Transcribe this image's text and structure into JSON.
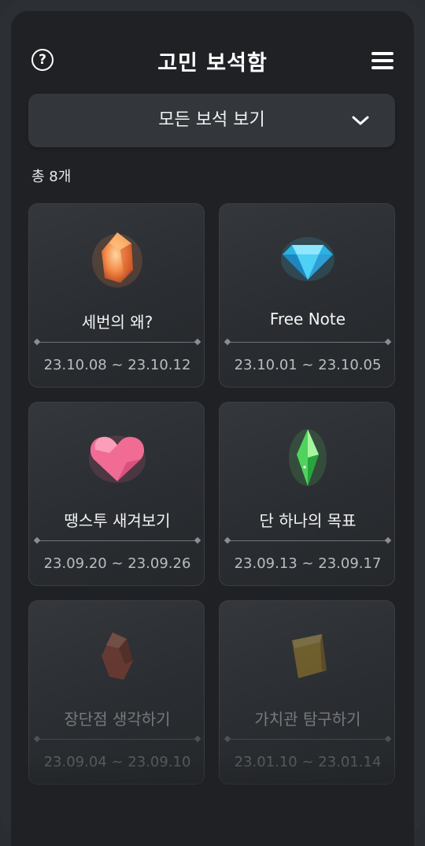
{
  "header": {
    "title": "고민 보석함",
    "help_symbol": "?"
  },
  "filter": {
    "label": "모든 보석 보기"
  },
  "summary": {
    "count_text": "총 8개"
  },
  "cards": [
    {
      "title": "세번의 왜?",
      "date": "23.10.08 ~ 23.10.12",
      "gem": "orange-crystal-icon",
      "color": "#f08a4b"
    },
    {
      "title": "Free Note",
      "date": "23.10.01 ~ 23.10.05",
      "gem": "blue-diamond-icon",
      "color": "#3cc7ef"
    },
    {
      "title": "땡스투 새겨보기",
      "date": "23.09.20 ~ 23.09.26",
      "gem": "pink-heart-gem-icon",
      "color": "#f0668f"
    },
    {
      "title": "단 하나의 목표",
      "date": "23.09.13 ~ 23.09.17",
      "gem": "green-crystal-icon",
      "color": "#5fe06a"
    },
    {
      "title": "장단점 생각하기",
      "date": "23.09.04 ~ 23.09.10",
      "gem": "red-stone-icon",
      "color": "#b7452e"
    },
    {
      "title": "가치관 탐구하기",
      "date": "23.01.10 ~ 23.01.14",
      "gem": "yellow-topaz-icon",
      "color": "#d9a823"
    }
  ]
}
